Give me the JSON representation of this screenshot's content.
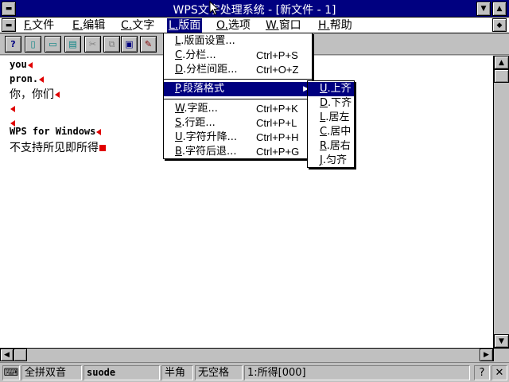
{
  "window": {
    "title": "WPS文字处理系统 - [新文件 - 1]",
    "sys_menu_glyph": "▬",
    "minimize_glyph": "▼",
    "maximize_glyph": "▲"
  },
  "menubar": {
    "doc_sys_glyph": "▬",
    "items": [
      {
        "key": "F.",
        "label": "文件"
      },
      {
        "key": "E.",
        "label": "编辑"
      },
      {
        "key": "C.",
        "label": "文字"
      },
      {
        "key": "L.",
        "label": "版面"
      },
      {
        "key": "O.",
        "label": "选项"
      },
      {
        "key": "W.",
        "label": "窗口"
      },
      {
        "key": "H.",
        "label": "帮助"
      }
    ],
    "restore_glyph": "◆"
  },
  "toolbar": {
    "buttons": [
      {
        "icon": "help-icon",
        "glyph": "?"
      },
      {
        "icon": "new-file-icon",
        "glyph": "▯"
      },
      {
        "icon": "open-file-icon",
        "glyph": "▭"
      },
      {
        "icon": "save-icon",
        "glyph": "▤"
      },
      {
        "icon": "cut-icon",
        "glyph": "✂"
      },
      {
        "icon": "copy-icon",
        "glyph": "⧉"
      },
      {
        "icon": "paste-icon",
        "glyph": "▣"
      },
      {
        "icon": "format-brush-icon",
        "glyph": "✎"
      }
    ]
  },
  "document": {
    "lines": [
      "you",
      "pron.",
      "你，你们",
      "",
      "",
      "WPS for Windows",
      "不支持所见即所得"
    ]
  },
  "layout_menu": {
    "items": [
      {
        "key": "L",
        "label": ".版面设置...",
        "shortcut": ""
      },
      {
        "key": "C",
        "label": ".分栏...",
        "shortcut": "Ctrl+P+S"
      },
      {
        "key": "D",
        "label": ".分栏间距...",
        "shortcut": "Ctrl+O+Z"
      },
      {
        "key": "P",
        "label": ".段落格式",
        "shortcut": ""
      },
      {
        "key": "W",
        "label": ".字距...",
        "shortcut": "Ctrl+P+K"
      },
      {
        "key": "S",
        "label": ".行距...",
        "shortcut": "Ctrl+P+L"
      },
      {
        "key": "U",
        "label": ".字符升降...",
        "shortcut": "Ctrl+P+H"
      },
      {
        "key": "B",
        "label": ".字符后退...",
        "shortcut": "Ctrl+P+G"
      }
    ],
    "submenu_arrow": "▶"
  },
  "paragraph_submenu": {
    "items": [
      {
        "key": "U",
        "label": ".上齐"
      },
      {
        "key": "D",
        "label": ".下齐"
      },
      {
        "key": "L",
        "label": ".居左"
      },
      {
        "key": "C",
        "label": ".居中"
      },
      {
        "key": "R",
        "label": ".居右"
      },
      {
        "key": "J",
        "label": ".匀齐"
      }
    ]
  },
  "statusbar": {
    "input_method": "全拼双音",
    "input_code": "suode",
    "width_mode": "半角",
    "space_mode": "无空格",
    "candidate": "1:所得[000]",
    "help_glyph": "?",
    "ime_glyph": "⌨"
  },
  "colors": {
    "title_bar": "#000080",
    "highlight": "#000080",
    "marker_red": "#e00000",
    "face": "#c0c0c0"
  }
}
